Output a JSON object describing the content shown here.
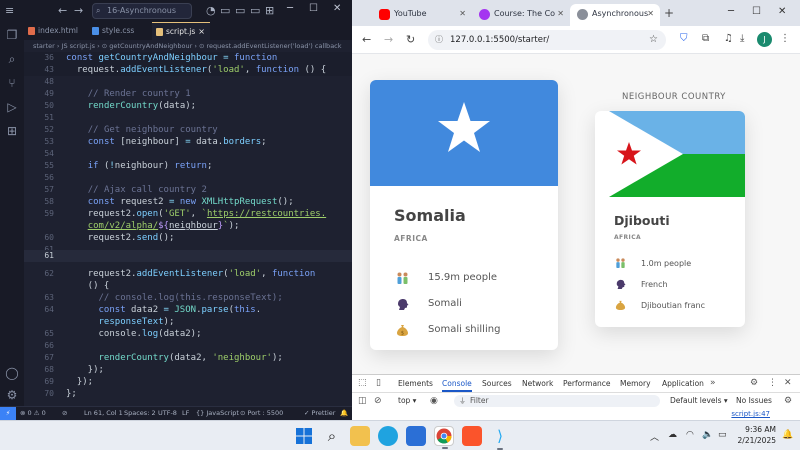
{
  "vscode": {
    "search_text": "16-Asynchronous",
    "tabs": [
      {
        "label": "index.html",
        "color": "#e06c4b"
      },
      {
        "label": "style.css",
        "color": "#4a8fe7"
      },
      {
        "label": "script.js",
        "color": "#e5c07b"
      }
    ],
    "tab_close": "×",
    "breadcrumb": "starter › JS script.js › ⊙ getCountryAndNeighbour › ⊙ request.addEventListener('load') callback",
    "status": {
      "remote": "⚡",
      "problems": "⊗ 0 ⚠ 0",
      "broadcast": "⊘",
      "position": "Ln 61, Col 1",
      "spaces": "Spaces: 2",
      "encoding": "UTF-8",
      "eol": "LF",
      "language": "{} JavaScript",
      "port": "⊙ Port : 5500",
      "prettier": "✓ Prettier",
      "bell": "🔔"
    }
  },
  "browser": {
    "tabs": [
      {
        "title": "YouTube",
        "color": "#ff0000"
      },
      {
        "title": "Course: The Co",
        "color": "#a435f0"
      },
      {
        "title": "Asynchronous",
        "color": "#8a8f99"
      }
    ],
    "url": "127.0.0.1:5500/starter/",
    "profile_initial": "J",
    "neighbour_label": "NEIGHBOUR COUNTRY",
    "countries": [
      {
        "name": "Somalia",
        "region": "AFRICA",
        "population": "15.9m people",
        "language": "Somali",
        "currency": "Somali shilling"
      },
      {
        "name": "Djibouti",
        "region": "AFRICA",
        "population": "1.0m people",
        "language": "French",
        "currency": "Djiboutian franc"
      }
    ],
    "devtools": {
      "tabs": [
        "Elements",
        "Console",
        "Sources",
        "Network",
        "Performance",
        "Memory",
        "Application"
      ],
      "active_tab": "Console",
      "context": "top ▾",
      "filter_placeholder": "Filter",
      "levels": "Default levels ▾",
      "issues": "No Issues",
      "log_source": "script.js:47"
    }
  },
  "taskbar": {
    "time": "9:36 AM",
    "date": "2/21/2025"
  }
}
